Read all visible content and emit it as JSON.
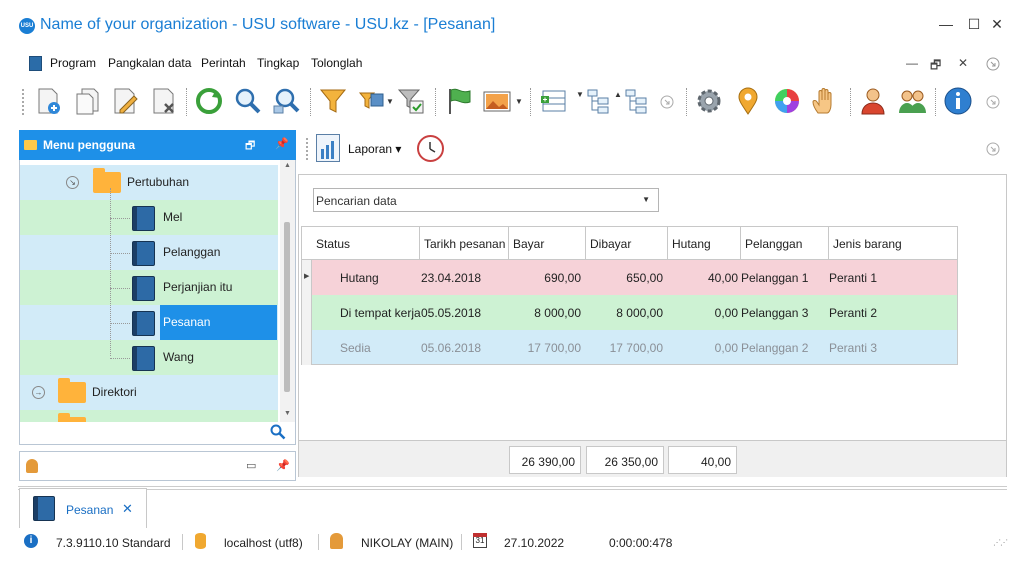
{
  "window": {
    "logo_text": "USU",
    "title": "Name of your organization - USU software - USU.kz - [Pesanan]",
    "minimize": "—",
    "maximize": "☐",
    "close": "✕"
  },
  "menu": {
    "items": [
      "Program",
      "Pangkalan data",
      "Perintah",
      "Tingkap",
      "Tolonglah"
    ],
    "mdi_minimize": "—",
    "mdi_restore": "🗗",
    "mdi_close": "✕"
  },
  "toolbar": {
    "icons": [
      "add-document-icon",
      "copy-document-icon",
      "edit-document-icon",
      "delete-document-icon",
      "refresh-icon",
      "search-icon",
      "search-advanced-icon",
      "filter-icon",
      "filter-settings-icon",
      "filter-clear-icon",
      "flag-icon",
      "image-icon",
      "expand-rows-icon",
      "tree-expand-icon",
      "tree-collapse-icon",
      "settings-gear-icon",
      "map-pin-icon",
      "color-wheel-icon",
      "hand-icon",
      "user-icon",
      "users-icon",
      "info-icon"
    ]
  },
  "left_panel": {
    "title": "Menu pengguna",
    "tree": [
      {
        "label": "Pertubuhan",
        "type": "folder",
        "level": 1
      },
      {
        "label": "Mel",
        "type": "book",
        "level": 2
      },
      {
        "label": "Pelanggan",
        "type": "book",
        "level": 2
      },
      {
        "label": "Perjanjian itu",
        "type": "book",
        "level": 2
      },
      {
        "label": "Pesanan",
        "type": "book",
        "level": 2,
        "selected": true
      },
      {
        "label": "Wang",
        "type": "book",
        "level": 2
      },
      {
        "label": "Direktori",
        "type": "folder",
        "level": 0
      }
    ]
  },
  "content": {
    "report_label": "Laporan",
    "search_dropdown": "Pencarian data",
    "columns": [
      "Status",
      "Tarikh pesanan",
      "Bayar",
      "Dibayar",
      "Hutang",
      "Pelanggan",
      "Jenis barang"
    ],
    "rows": [
      {
        "status": "Hutang",
        "date": "23.04.2018",
        "bayar": "690,00",
        "dibayar": "650,00",
        "hutang": "40,00",
        "pelanggan": "Pelanggan 1",
        "jenis": "Peranti 1",
        "color": "#f6d2d8"
      },
      {
        "status": "Di tempat kerja",
        "date": "05.05.2018",
        "bayar": "8 000,00",
        "dibayar": "8 000,00",
        "hutang": "0,00",
        "pelanggan": "Pelanggan 3",
        "jenis": "Peranti 2",
        "color": "#cdf2d3"
      },
      {
        "status": "Sedia",
        "date": "05.06.2018",
        "bayar": "17 700,00",
        "dibayar": "17 700,00",
        "hutang": "0,00",
        "pelanggan": "Pelanggan 2",
        "jenis": "Peranti 3",
        "color": "#d2ebf8",
        "muted": true
      }
    ],
    "totals": {
      "bayar": "26 390,00",
      "dibayar": "26 350,00",
      "hutang": "40,00"
    }
  },
  "tab": {
    "label": "Pesanan",
    "close": "✕"
  },
  "status": {
    "version": "7.3.9110.10 Standard",
    "db": "localhost (utf8)",
    "user": "NIKOLAY (MAIN)",
    "calendar_day": "31",
    "date": "27.10.2022",
    "timer": "0:00:00:478"
  },
  "colors": {
    "accent": "#1e90e8",
    "tree_blue": "#d2ebf8",
    "tree_green": "#cdf2d3"
  }
}
